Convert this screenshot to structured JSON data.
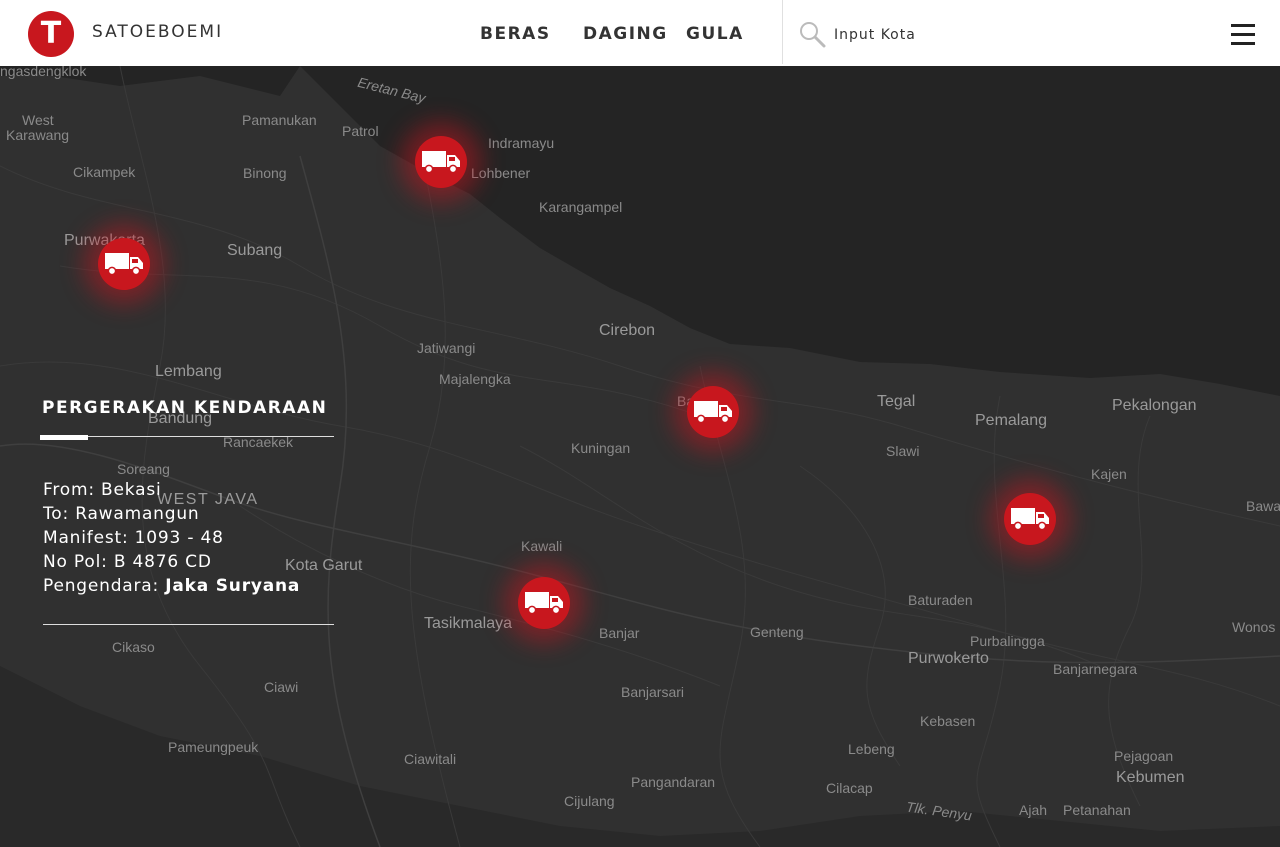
{
  "header": {
    "brand": "SATOEBOEMI",
    "logo_letter": "T",
    "nav": [
      "BERAS",
      "DAGING",
      "GULA"
    ],
    "search_placeholder": "Input Kota"
  },
  "map": {
    "places": [
      "ngasdengklok",
      "West",
      "Karawang",
      "Eretan Bay",
      "Pamanukan",
      "Patrol",
      "Indramayu",
      "Lohbener",
      "Cikampek",
      "Binong",
      "Karangampel",
      "Purwakarta",
      "Subang",
      "Cirebon",
      "Jatiwangi",
      "Majalengka",
      "Lembang",
      "Bandung",
      "Rancaekek",
      "Tegal",
      "Pemalang",
      "Pekalongan",
      "Kuningan",
      "Slawi",
      "Soreang",
      "WEST JAVA",
      "Kajen",
      "Bawa",
      "Kawali",
      "Kota Garut",
      "Tasikmalaya",
      "Banjar",
      "Genteng",
      "Baturaden",
      "Purbalingga",
      "Purwokerto",
      "Banjarnegara",
      "Wonos",
      "Cikaso",
      "Ciawi",
      "Banjarsari",
      "Kebasen",
      "Pameungpeuk",
      "Ciawitali",
      "Lebeng",
      "Pejagoan",
      "Kebumen",
      "Pangandaran",
      "Cilacap",
      "Cijulang",
      "Tlk. Penyu",
      "Ajah",
      "Petanahan",
      "Ba"
    ]
  },
  "panel": {
    "title": "PERGERAKAN KENDARAAN",
    "from": "From: Bekasi",
    "to": "To: Rawamangun",
    "manifest": "Manifest: 1093 - 48",
    "nopol": "No Pol: B 4876 CD",
    "driver_label": "Pengendara: ",
    "driver_name": "Jaka Suryana"
  },
  "icons": {
    "search": "search-icon",
    "menu": "hamburger-menu-icon",
    "truck": "truck-icon"
  },
  "colors": {
    "accent": "#c8171e",
    "map_bg": "#262626",
    "header_bg": "#ffffff"
  }
}
